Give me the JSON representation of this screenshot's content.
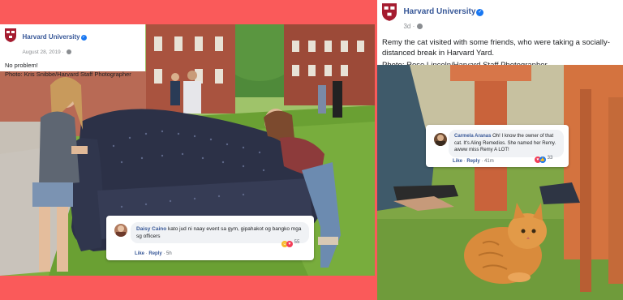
{
  "left_post": {
    "org_name": "Harvard University",
    "date": "August 28, 2019 · ",
    "text": "No problem!",
    "photo_credit": "Photo: Kris Snibbe/Harvard Staff Photographer",
    "comment": {
      "author": "Daisy Caino",
      "text": "kato jud ni naay event sa gym, gipahakot og bangko mga sg officers",
      "like": "Like",
      "reply": "Reply",
      "time": "5h",
      "reaction_count": "55"
    }
  },
  "right_post": {
    "org_name": "Harvard University",
    "date": "3d · ",
    "text": "Remy the cat visited with some friends, who were taking a socially-distanced break in Harvard Yard.",
    "photo_credit": "Photo: Rose Lincoln/Harvard Staff Photographer",
    "comment": {
      "author": "Carmela Aranas",
      "text": "Oh! I know the owner of that cat. It's Aling Remedios. She named her Remy. awww miss Remy A LOT!",
      "like": "Like",
      "reply": "Reply",
      "time": "41m",
      "reaction_count": "33"
    }
  },
  "colors": {
    "background": "#fa5a5a",
    "link_blue": "#385898",
    "verified_blue": "#1877f2",
    "harvard_crimson": "#a51c30"
  },
  "icons": [
    "harvard-shield-icon",
    "verified-badge-icon",
    "globe-icon",
    "haha-reaction-icon",
    "love-reaction-icon",
    "like-reaction-icon"
  ]
}
